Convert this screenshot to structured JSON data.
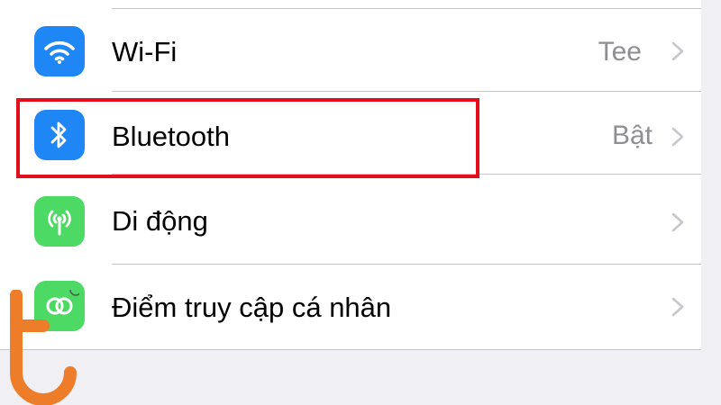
{
  "colors": {
    "wifi_tile": "#1f87f5",
    "bluetooth_tile": "#1f87f5",
    "cellular_tile": "#4cd964",
    "hotspot_tile": "#4cd964",
    "value_text": "#8e8e93",
    "chevron": "#c7c7cc",
    "highlight": "#e30e1b",
    "watermark": "#ee7d2a"
  },
  "rows": [
    {
      "label": "Wi-Fi",
      "value": "Tee",
      "icon": "wifi-icon"
    },
    {
      "label": "Bluetooth",
      "value": "Bật",
      "icon": "bluetooth-icon"
    },
    {
      "label": "Di động",
      "value": "",
      "icon": "cellular-antenna-icon"
    },
    {
      "label": "Điểm truy cập cá nhân",
      "value": "",
      "icon": "personal-hotspot-icon"
    }
  ],
  "highlighted_row": "Bluetooth",
  "watermark": {
    "icon": "brand-logo-mark"
  }
}
